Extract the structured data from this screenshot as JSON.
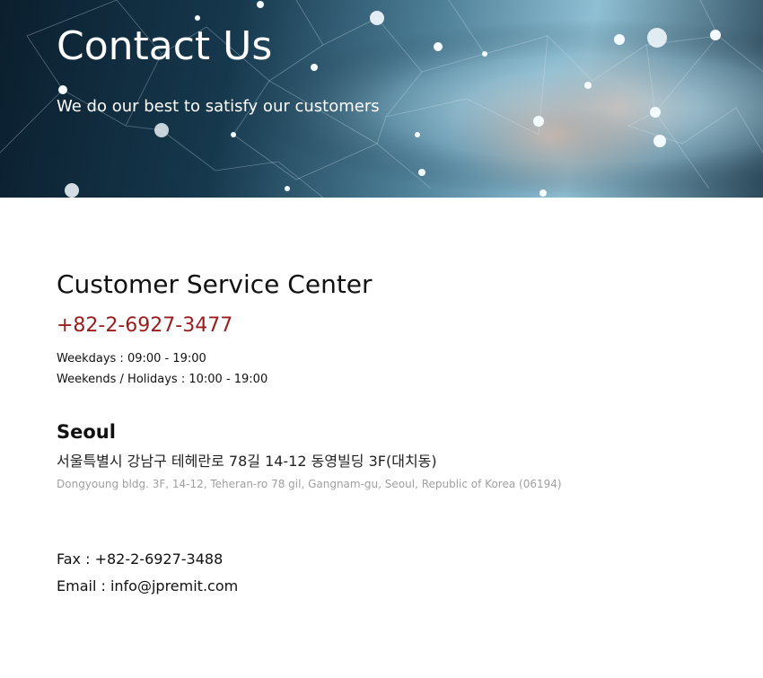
{
  "hero": {
    "title": "Contact Us",
    "subtitle": "We do our best to satisfy our customers",
    "image_icon": "globe-network-hand-image"
  },
  "service": {
    "title": "Customer Service Center",
    "phone": "+82-2-6927-3477",
    "phone_color": "#9b1c1c",
    "hours": [
      "Weekdays : 09:00 - 19:00",
      "Weekends / Holidays : 10:00 - 19:00"
    ]
  },
  "office": {
    "city": "Seoul",
    "address_ko": "서울특별시 강남구 테헤란로 78길 14-12 동영빌딩 3F(대치동)",
    "address_en": "Dongyoung bldg. 3F, 14-12, Teheran-ro 78 gil, Gangnam-gu, Seoul, Republic of Korea (06194)"
  },
  "contact": {
    "fax": "Fax : +82-2-6927-3488",
    "email": "Email : info@jpremit.com"
  }
}
